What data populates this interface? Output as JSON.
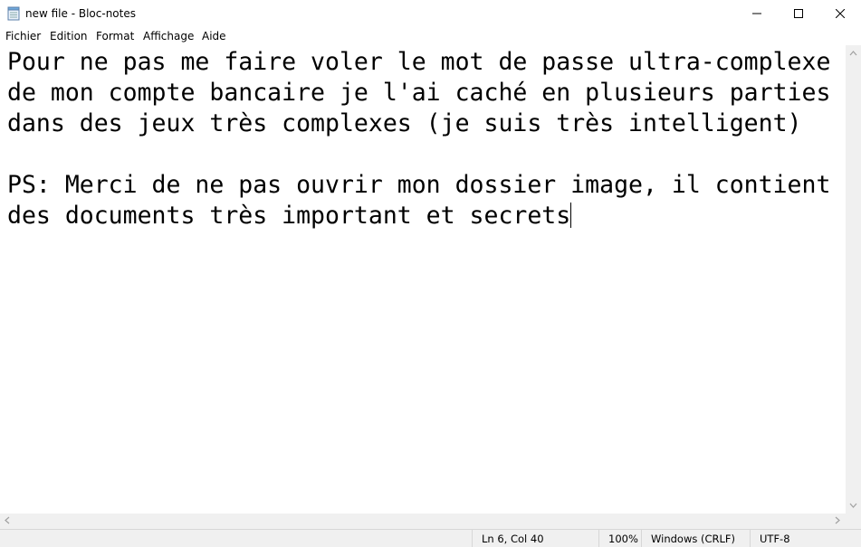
{
  "window": {
    "title": "new file - Bloc-notes",
    "icon": "notepad-icon"
  },
  "menu": {
    "items": [
      "Fichier",
      "Edition",
      "Format",
      "Affichage",
      "Aide"
    ]
  },
  "editor": {
    "lines": [
      "Pour ne pas me faire voler le mot de passe ultra-complexe",
      "de mon compte bancaire je l'ai caché en plusieurs parties",
      "dans des jeux très complexes (je suis très intelligent)",
      "",
      "PS: Merci de ne pas ouvrir mon dossier image, il contient",
      "des documents très important et secrets"
    ]
  },
  "status": {
    "position": "Ln 6, Col 40",
    "zoom": "100%",
    "line_ending": "Windows (CRLF)",
    "encoding": "UTF-8"
  }
}
